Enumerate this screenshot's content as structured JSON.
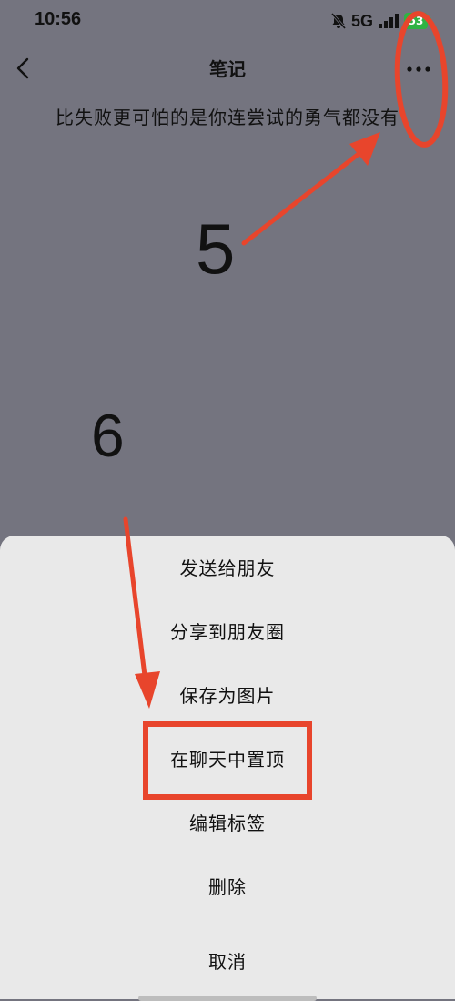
{
  "status_bar": {
    "time": "10:56",
    "network": "5G",
    "battery": "53"
  },
  "nav": {
    "title": "笔记"
  },
  "note": {
    "text": "比失败更可怕的是你连尝试的勇气都没有"
  },
  "annotations": {
    "step5": "5",
    "step6": "6",
    "color": "#e8452c"
  },
  "sheet": {
    "items": [
      "发送给朋友",
      "分享到朋友圈",
      "保存为图片",
      "在聊天中置顶",
      "编辑标签",
      "删除",
      "取消"
    ]
  },
  "icons": [
    "back-arrow-icon",
    "more-dots-icon",
    "mute-bell-icon",
    "signal-icon",
    "battery-icon"
  ]
}
